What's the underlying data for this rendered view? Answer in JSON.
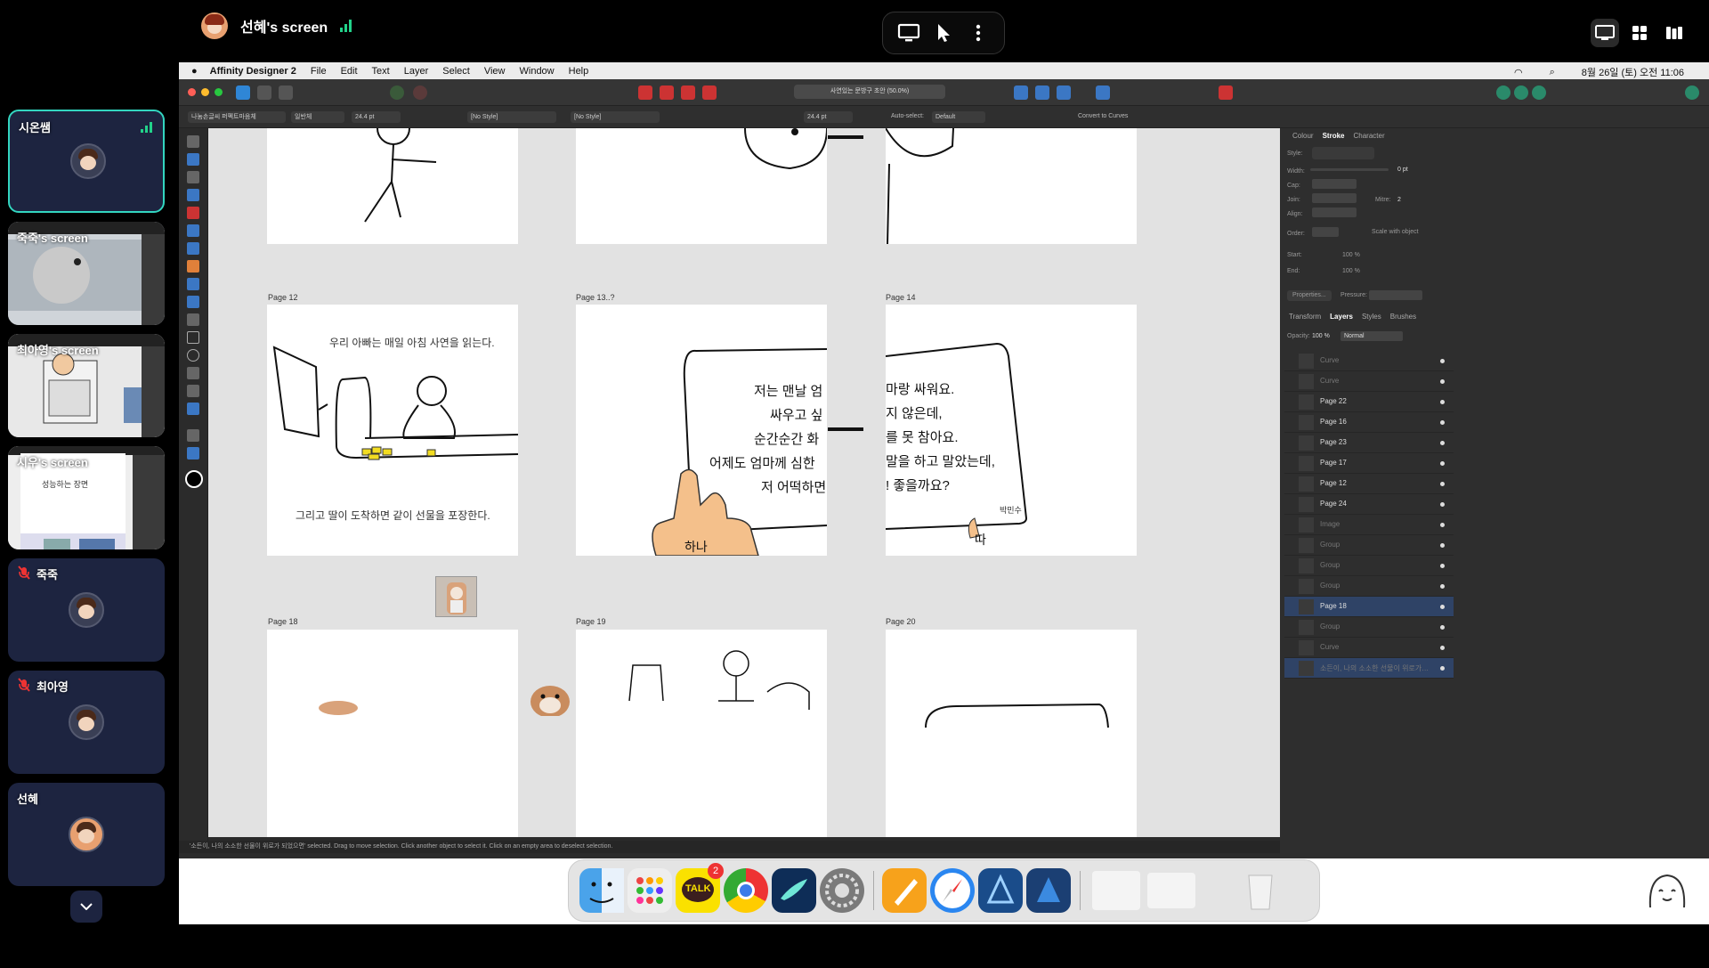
{
  "presenter": {
    "name": "선혜's screen"
  },
  "participants": [
    {
      "name": "시온쌤"
    },
    {
      "name": "죽죽's screen"
    },
    {
      "name": "최아영's screen"
    },
    {
      "name": "시우's screen"
    },
    {
      "name": "죽죽"
    },
    {
      "name": "최아영"
    },
    {
      "name": "선혜"
    }
  ],
  "thumb_texts": {
    "siwoo_line1": "성능하는 장면"
  },
  "mac_menu": {
    "app": "Affinity Designer 2",
    "items": [
      "File",
      "Edit",
      "Text",
      "Layer",
      "Select",
      "View",
      "Window",
      "Help"
    ],
    "clock": "8월 26일 (토) 오전 11:06"
  },
  "document_tab": "사연있는 문방구 초안 (50.0%)",
  "context_toolbar": {
    "font": "나눔손글씨 퍼펙트마음체",
    "weight": "일반체",
    "size": "24.4 pt",
    "char_style": "[No Style]",
    "para_style": "[No Style]",
    "leading": "24.4 pt",
    "auto_select": "Auto-select:",
    "auto_select_value": "Default",
    "convert": "Convert to Curves"
  },
  "pages": {
    "p12": "Page 12",
    "p13": "Page 13..?",
    "p14": "Page 14",
    "p18": "Page 18",
    "p19": "Page 19",
    "p20": "Page 20"
  },
  "page12_text": {
    "line1": "우리 아빠는 매일 아침 사연을 읽는다.",
    "line2": "그리고 딸이 도착하면 같이 선물을 포장한다."
  },
  "page13_text": {
    "l1": "저는 맨날 엄",
    "l2": "싸우고 싶",
    "l3": "순간순간 화",
    "l4": "어제도 엄마께 심한",
    "l5": "저 어떡하면",
    "hand": "하나"
  },
  "page14_text": {
    "l1": "마랑 싸워요.",
    "l2": "지 않은데,",
    "l3": "를 못 참아요.",
    "l4": "말을 하고 말았는데,",
    "l5": "! 좋을까요?",
    "sig": "박민수",
    "hand": "따"
  },
  "right_panel": {
    "top_tabs": [
      "Colour",
      "Stroke",
      "Character"
    ],
    "style": "Style:",
    "width": "Width:",
    "width_value": "0 pt",
    "cap": "Cap:",
    "join": "Join:",
    "align": "Align:",
    "mitre": "Mitre:",
    "mitre_value": "2",
    "order": "Order:",
    "scale": "Scale with object",
    "start": "Start:",
    "end": "End:",
    "pct1": "100 %",
    "pct2": "100 %",
    "properties": "Properties...",
    "pressure": "Pressure:",
    "layer_tabs": [
      "Transform",
      "Layers",
      "Styles",
      "Brushes"
    ],
    "opacity": "Opacity:",
    "opacity_value": "100 %",
    "blend": "Normal",
    "layers": [
      {
        "name": "Curve",
        "dim": true
      },
      {
        "name": "Curve",
        "dim": true
      },
      {
        "name": "Page 22",
        "dim": false
      },
      {
        "name": "Page 16",
        "dim": false
      },
      {
        "name": "Page 23",
        "dim": false
      },
      {
        "name": "Page 17",
        "dim": false
      },
      {
        "name": "Page 12",
        "dim": false
      },
      {
        "name": "Page 24",
        "dim": false
      },
      {
        "name": "Image",
        "dim": true
      },
      {
        "name": "Group",
        "dim": true
      },
      {
        "name": "Group",
        "dim": true
      },
      {
        "name": "Group",
        "dim": true
      },
      {
        "name": "Page 18",
        "dim": false,
        "selected": true
      },
      {
        "name": "Group",
        "dim": true
      },
      {
        "name": "Curve",
        "dim": true
      },
      {
        "name": "소든이, 나의 소소한 선물이 위로가…",
        "dim": true,
        "selected": true
      }
    ]
  },
  "status_bar": "'소든이, 나의 소소한 선물이 위로가 되었으면' selected. Drag to move selection. Click another object to select it. Click on an empty area to deselect selection.",
  "dock": {
    "talk_badge": "2",
    "talk_label": "TALK"
  },
  "colors": {
    "accent": "#33d6c0",
    "tile_bg": "#1d2440",
    "signal": "#22d28a"
  }
}
